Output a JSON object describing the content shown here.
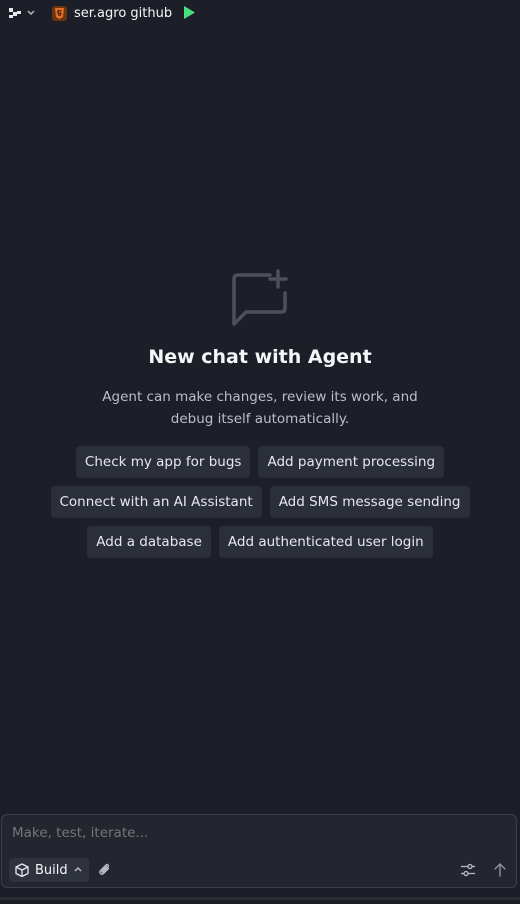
{
  "topbar": {
    "project_name": "ser.agro github",
    "project_icon": "html5-icon",
    "run_icon": "play-icon"
  },
  "empty_state": {
    "icon": "chat-add-icon",
    "title": "New chat with Agent",
    "subtitle": "Agent can make changes, review its work, and debug itself automatically."
  },
  "suggestions": [
    [
      "Check my app for bugs",
      "Add payment processing"
    ],
    [
      "Connect with an AI Assistant",
      "Add SMS message sending"
    ],
    [
      "Add a database",
      "Add authenticated user login"
    ]
  ],
  "composer": {
    "placeholder": "Make, test, iterate...",
    "mode_label": "Build"
  },
  "colors": {
    "background": "#1c1f28",
    "chip": "#2b2f3a",
    "run_green": "#4ade80",
    "html_orange": "#e2702c"
  }
}
